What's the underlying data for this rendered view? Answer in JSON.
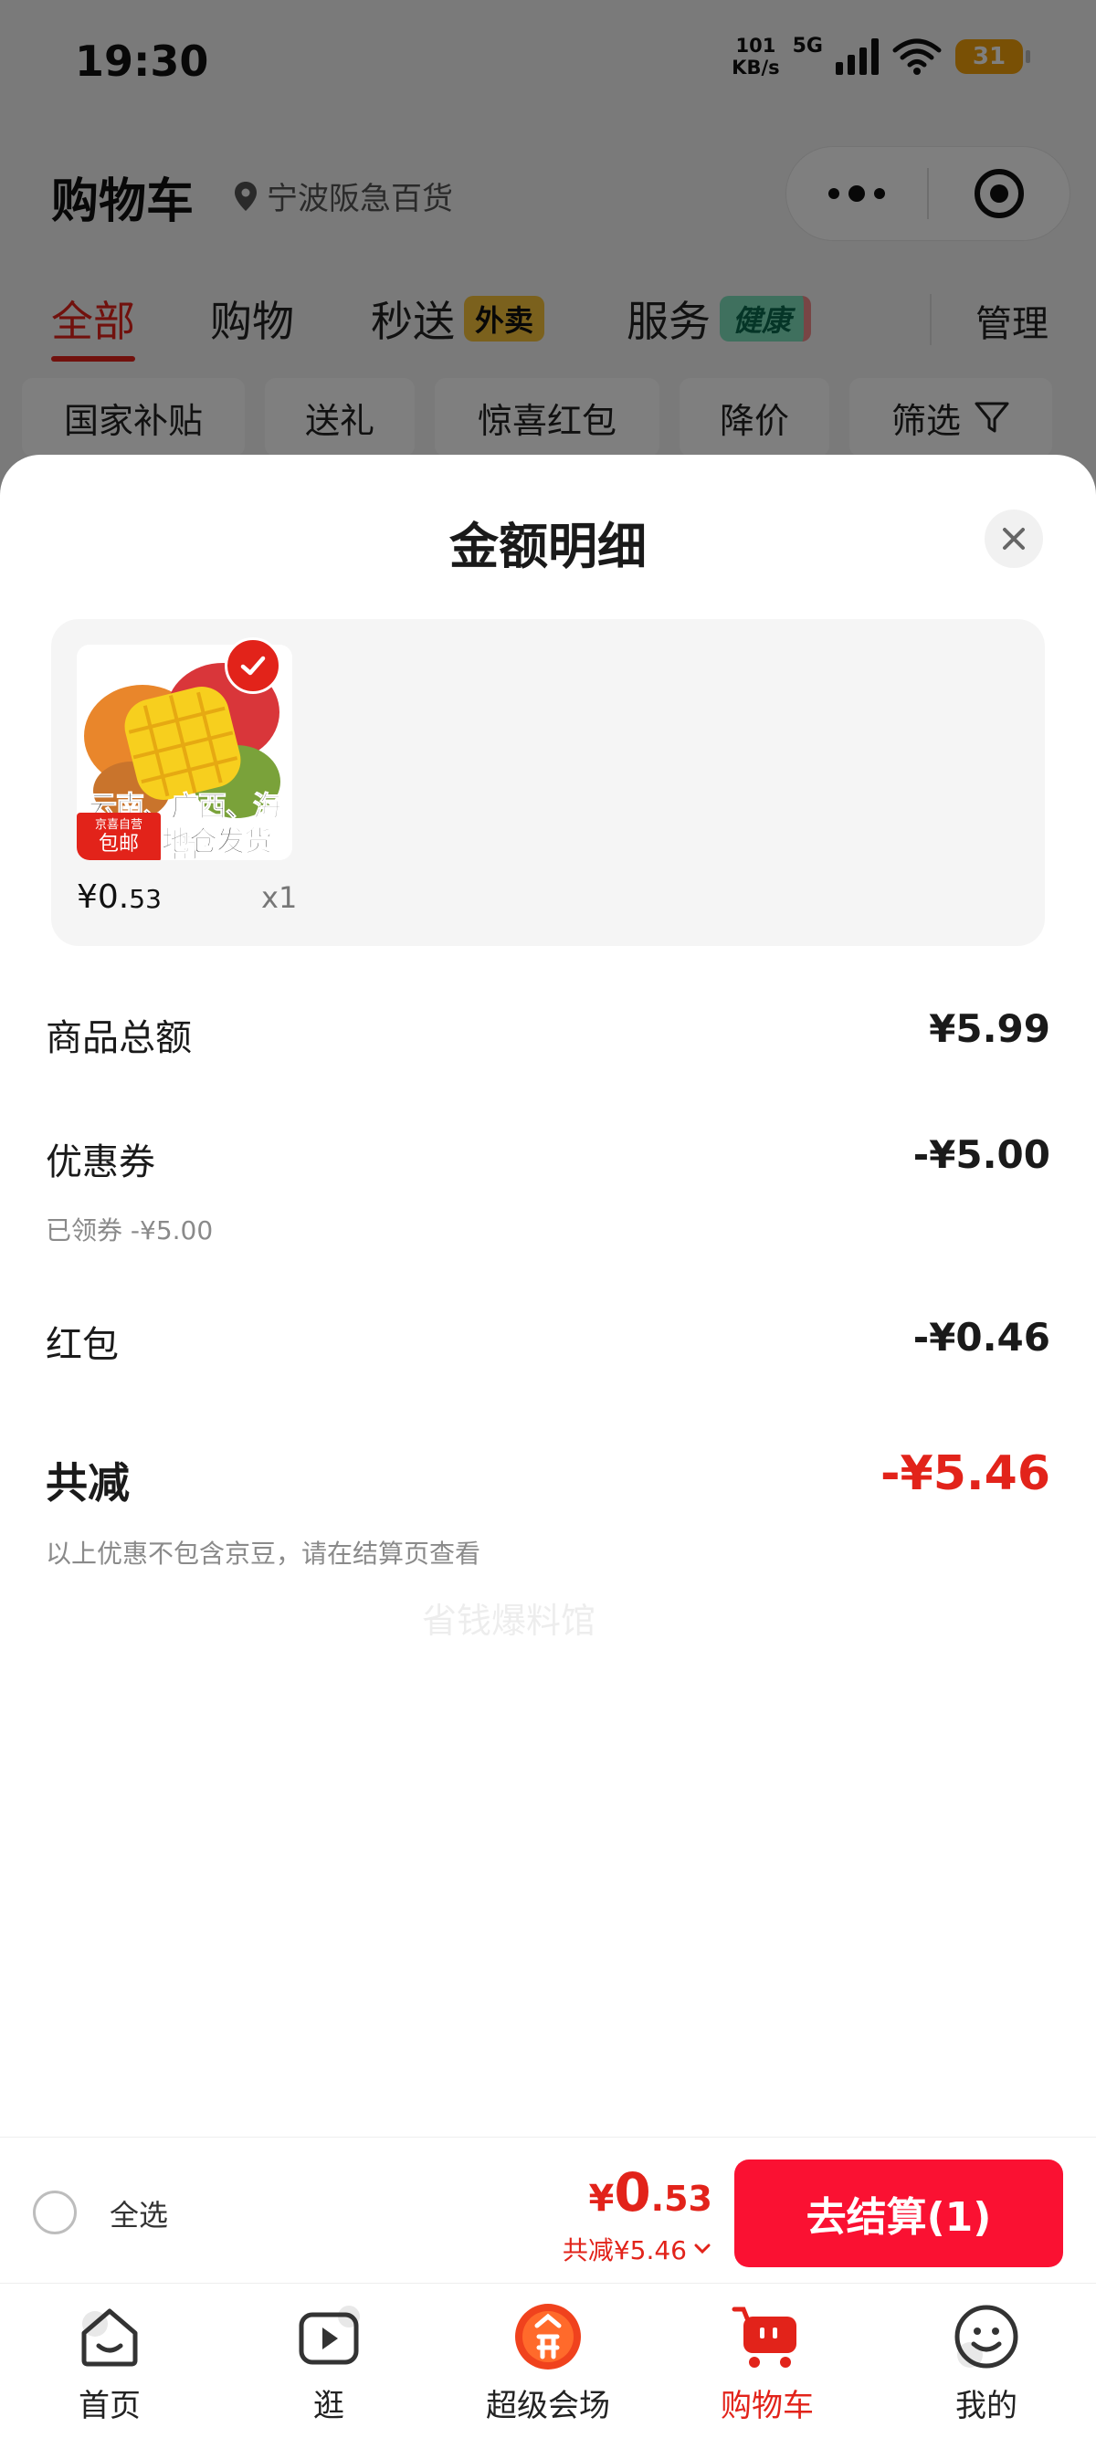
{
  "status_bar": {
    "time": "19:30",
    "net_speed_value": "101",
    "net_speed_unit": "KB/s",
    "network": "5G",
    "battery": "31"
  },
  "header": {
    "title": "购物车",
    "location": "宁波阪急百货"
  },
  "tabs": [
    {
      "label": "全部"
    },
    {
      "label": "购物"
    },
    {
      "label": "秒送",
      "tag": "外卖"
    },
    {
      "label": "服务",
      "tag": "健康"
    }
  ],
  "manage_label": "管理",
  "filters": [
    {
      "label": "国家补贴"
    },
    {
      "label": "送礼"
    },
    {
      "label": "惊喜红包"
    },
    {
      "label": "降价"
    },
    {
      "label": "筛选"
    }
  ],
  "sheet": {
    "title": "金额明细",
    "product": {
      "caption_line1": "云南、广西、海南",
      "caption_line2": "产地仓发货",
      "badge_top": "京喜自营",
      "badge_bottom": "包邮",
      "price_symbol": "¥",
      "price_int": "0.",
      "price_dec": "53",
      "quantity": "x1"
    },
    "rows": {
      "goods_total_label": "商品总额",
      "goods_total_value": "¥5.99",
      "coupon_label": "优惠券",
      "coupon_value": "-¥5.00",
      "coupon_sub": "已领券 -¥5.00",
      "redpacket_label": "红包",
      "redpacket_value": "-¥0.46",
      "total_discount_label": "共减",
      "total_discount_value": "-¥5.46",
      "note": "以上优惠不包含京豆，请在结算页查看"
    },
    "watermark": "省钱爆料馆"
  },
  "checkout": {
    "select_all": "全选",
    "amount_symbol": "¥",
    "amount_int": "0",
    "amount_dec": ".53",
    "discount_text": "共减¥5.46",
    "button": "去结算(1)"
  },
  "nav": [
    {
      "label": "首页",
      "icon": "home-icon"
    },
    {
      "label": "逛",
      "icon": "video-icon"
    },
    {
      "label": "超级会场",
      "icon": "super-venue-icon"
    },
    {
      "label": "购物车",
      "icon": "cart-icon",
      "active": true
    },
    {
      "label": "我的",
      "icon": "profile-icon"
    }
  ],
  "colors": {
    "accent": "#e2231a",
    "checkout_button": "#fa1132",
    "waimai_tag": "#f6c33b",
    "health_tag": "#7fe0bd"
  }
}
